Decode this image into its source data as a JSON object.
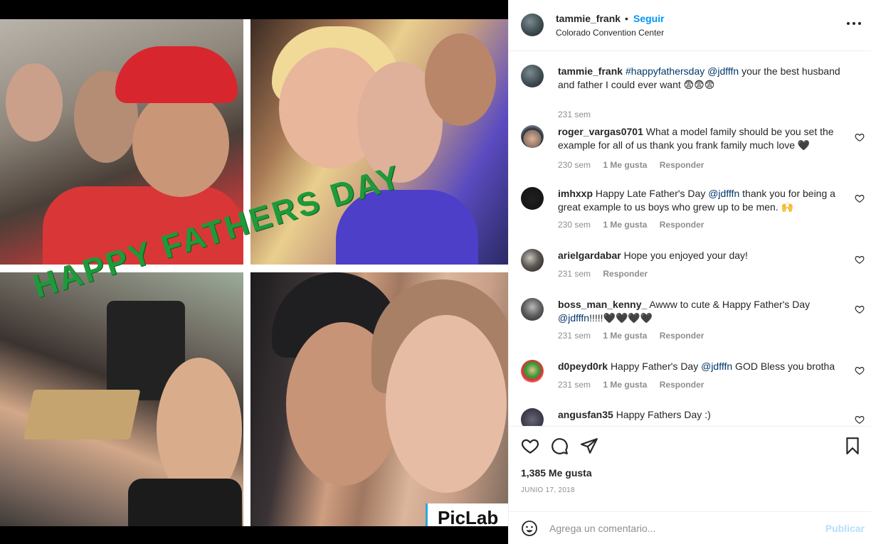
{
  "media": {
    "banner_text": "HAPPY FATHERS DAY",
    "watermark": "PicLab"
  },
  "header": {
    "username": "tammie_frank",
    "separator": "•",
    "follow_label": "Seguir",
    "location": "Colorado Convention Center"
  },
  "caption": {
    "username": "tammie_frank",
    "hashtag": "#happyfathersday",
    "mention": "@jdfffn",
    "text": " your the best husband and father I could ever want 😨😨😨",
    "time": "231 sem"
  },
  "comments": [
    {
      "username": "roger_vargas0701",
      "mention": "",
      "text": "What a model family should be you set the example for all of us thank you frank family much love 🖤",
      "time": "230 sem",
      "likes": "1 Me gusta",
      "reply": "Responder"
    },
    {
      "username": "imhxxp",
      "text_before": "Happy Late Father's Day ",
      "mention": "@jdfffn",
      "text": " thank you for being a great example to us boys who grew up to be men. 🙌",
      "time": "230 sem",
      "likes": "1 Me gusta",
      "reply": "Responder"
    },
    {
      "username": "arielgardabar",
      "text": "Hope you enjoyed your day!",
      "time": "231 sem",
      "reply": "Responder"
    },
    {
      "username": "boss_man_kenny_",
      "text_before": "Awww to cute & Happy Father's Day ",
      "mention": "@jdfffn",
      "text": "!!!!!🖤🖤🖤🖤",
      "time": "231 sem",
      "likes": "1 Me gusta",
      "reply": "Responder"
    },
    {
      "username": "d0peyd0rk",
      "text_before": "Happy Father's Day ",
      "mention": "@jdfffn",
      "text": " GOD Bless you brotha",
      "time": "231 sem",
      "likes": "1 Me gusta",
      "reply": "Responder"
    },
    {
      "username": "angusfan35",
      "text": "Happy Fathers Day :)"
    }
  ],
  "actions": {
    "likes_count": "1,385 Me gusta",
    "date": "JUNIO 17, 2018"
  },
  "composer": {
    "placeholder": "Agrega un comentario...",
    "publish_label": "Publicar"
  },
  "colors": {
    "accent": "#0095f6",
    "mention": "#00376b",
    "meta": "#8e8e8e",
    "publish_disabled": "#b2dffc",
    "banner_green": "#1e9a3b"
  }
}
